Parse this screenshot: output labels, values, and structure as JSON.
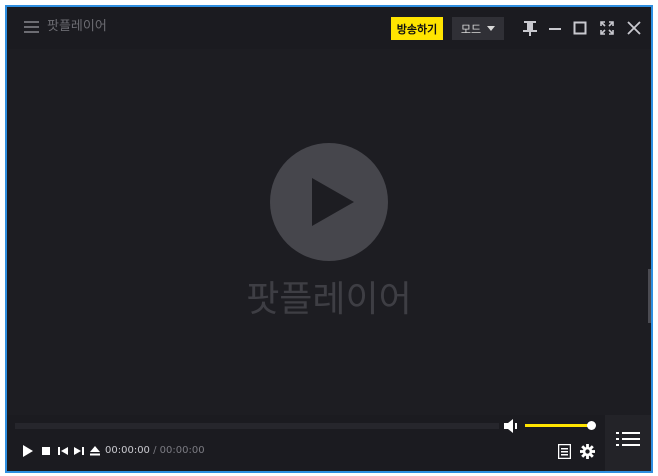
{
  "titlebar": {
    "app_title": "팟플레이어",
    "broadcast_label": "방송하기",
    "mode_label": "모드",
    "icons": {
      "menu": "hamburger-menu-icon",
      "pin": "pin-icon",
      "minimize": "minimize-icon",
      "maximize": "maximize-icon",
      "fullscreen": "fullscreen-icon",
      "close": "close-icon"
    }
  },
  "video": {
    "watermark": "팟플레이어",
    "icon": "play-icon"
  },
  "controls": {
    "current_time": "00:00:00",
    "separator": "/",
    "total_time": "00:00:00",
    "volume_level": 1.0,
    "seek_progress": 0.0,
    "icons": [
      "play-icon",
      "stop-icon",
      "previous-icon",
      "next-icon",
      "eject-icon",
      "volume-icon",
      "chapter-list-icon",
      "settings-icon",
      "playlist-icon"
    ]
  },
  "colors": {
    "accent": "#ffe400",
    "window_border": "#2f8fe0",
    "background": "#1b1b20"
  }
}
